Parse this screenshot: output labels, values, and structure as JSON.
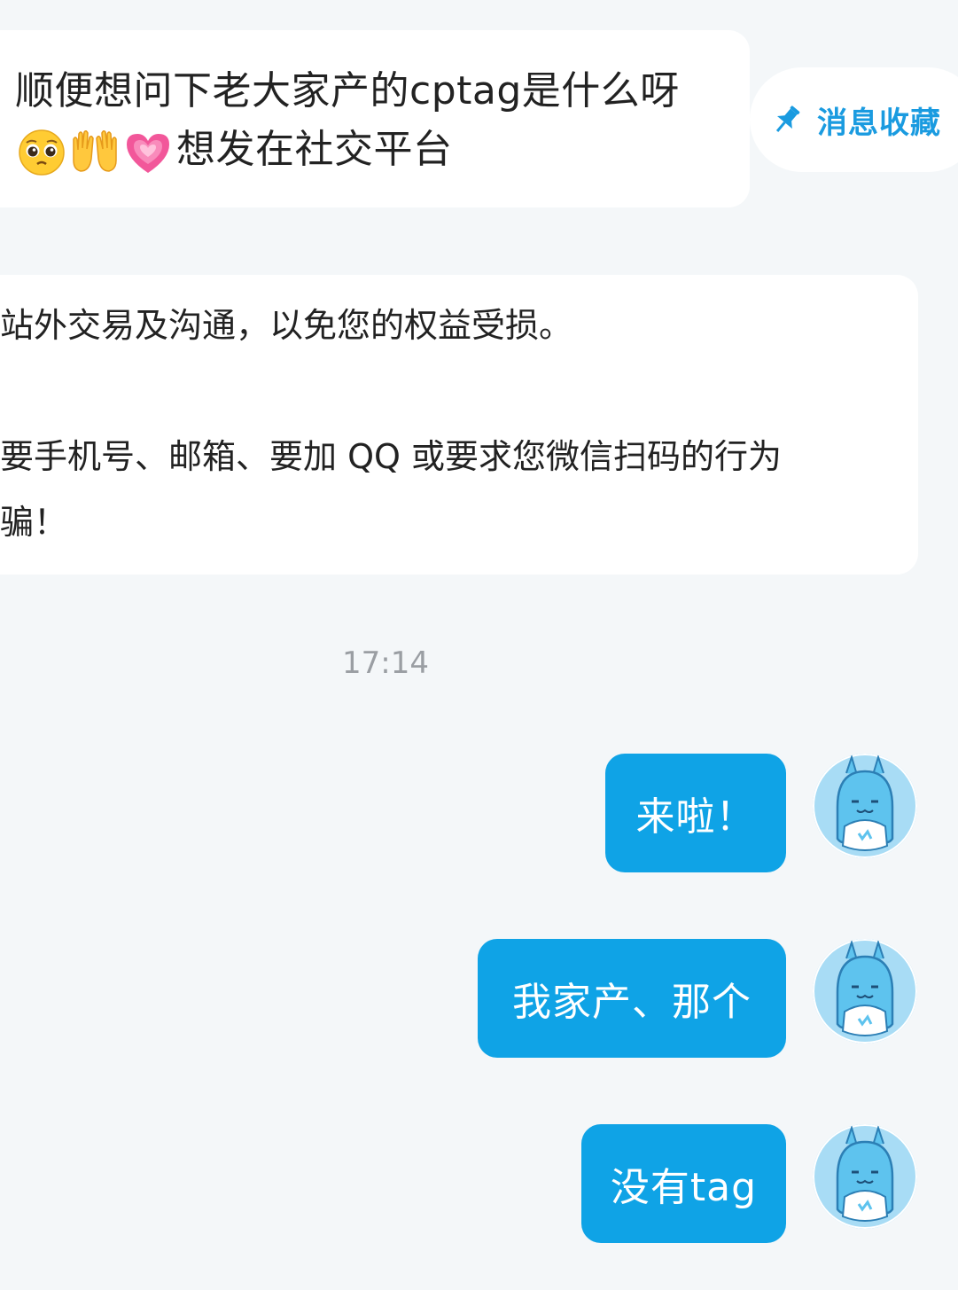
{
  "incoming_message": {
    "line1": "顺便想问下老大家产的cptag是什么呀",
    "emojis": [
      "pleading-face-emoji",
      "raised-hands-emoji",
      "growing-heart-emoji"
    ],
    "line2": "想发在社交平台"
  },
  "pin_action": {
    "label": "消息收藏",
    "icon": "pin-icon",
    "color": "#1a9be0"
  },
  "system_notice": {
    "lines": [
      "站外交易及沟通，以免您的权益受损。",
      "要手机号、邮箱、要加 QQ 或要求您微信扫码的行为",
      "骗！"
    ]
  },
  "timestamp": "17:14",
  "outgoing_messages": [
    {
      "text": "来啦！"
    },
    {
      "text": "我家产、那个"
    },
    {
      "text": "没有tag"
    }
  ],
  "colors": {
    "background": "#f4f7f9",
    "outgoing_bubble": "#0fa3e6",
    "incoming_bubble": "#ffffff",
    "timestamp_text": "#9a9ea3"
  },
  "avatar_icon": "blue-rabbit-avatar"
}
